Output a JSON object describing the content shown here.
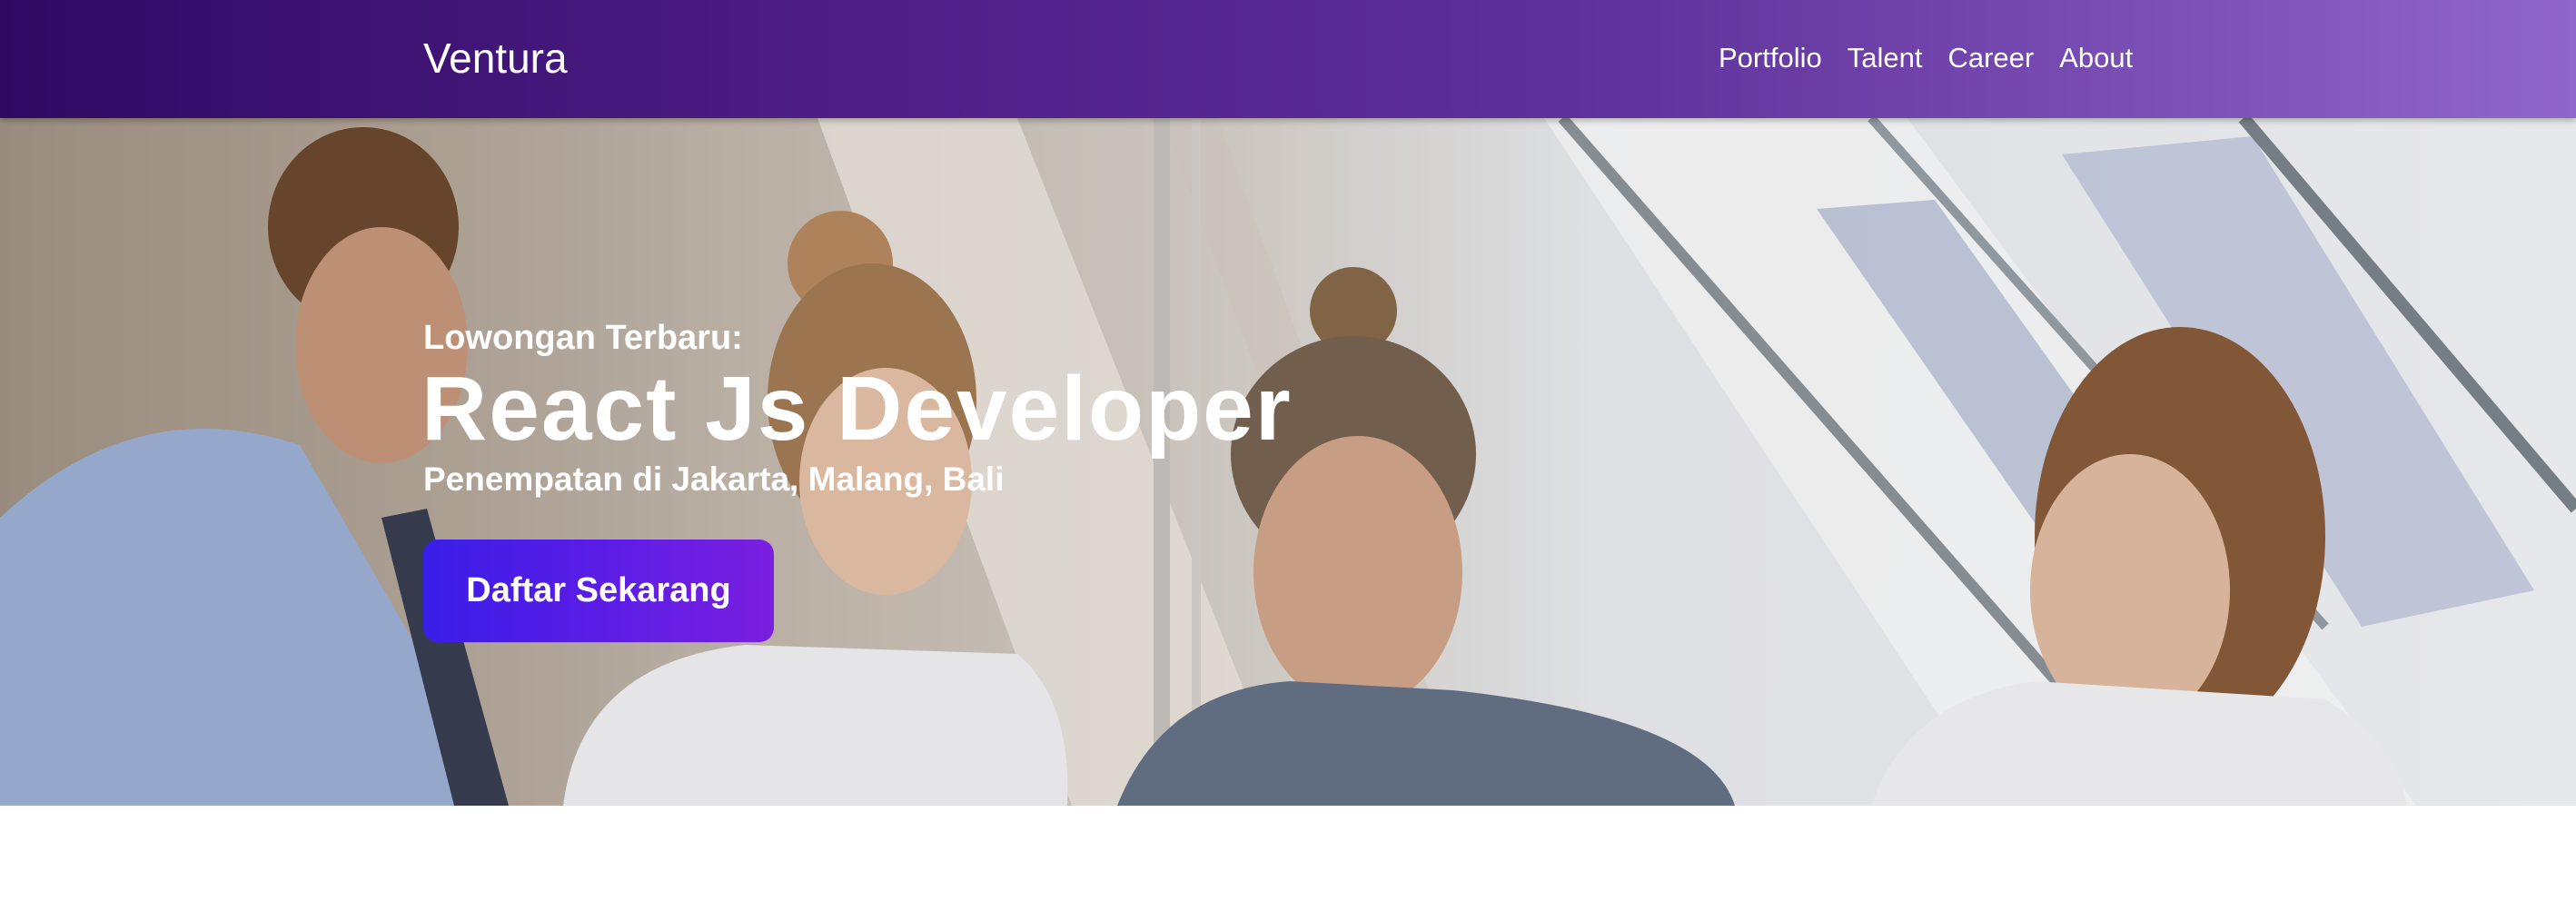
{
  "navbar": {
    "brand": "Ventura",
    "links": [
      "Portfolio",
      "Talent",
      "Career",
      "About"
    ]
  },
  "hero": {
    "kicker": "Lowongan Terbaru:",
    "title": "React Js Developer",
    "subtitle": "Penempatan di Jakarta, Malang, Bali",
    "cta_label": "Daftar Sekarang",
    "image_alt": "Four colleagues in office looking at a device"
  },
  "colors": {
    "nav_gradient_start": "#2f0a63",
    "nav_gradient_end": "#8f66c9",
    "cta_gradient_start": "#3a1de8",
    "cta_gradient_end": "#7a1fdf",
    "text": "#ffffff"
  }
}
